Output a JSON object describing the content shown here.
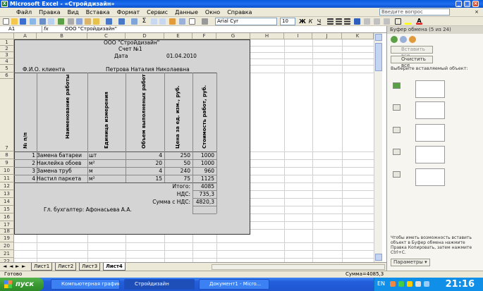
{
  "window": {
    "app_icon": "X",
    "title": "Microsoft Excel - «Стройдизайн»",
    "buttons": {
      "minimize": "_",
      "maximize": "□",
      "close": "×"
    }
  },
  "menu": {
    "items": [
      "Файл",
      "Правка",
      "Вид",
      "Вставка",
      "Формат",
      "Сервис",
      "Данные",
      "Окно",
      "Справка"
    ],
    "help_placeholder": "Введите вопрос",
    "mdi_close": "×"
  },
  "toolbar": {
    "font": "Arial Cyr",
    "size": "10",
    "zoom_label": "Σ"
  },
  "formula_bar": {
    "name_box": "A1",
    "fx": "fx",
    "content": "ООО \"Стройдизайн\""
  },
  "columns": [
    "A",
    "B",
    "C",
    "D",
    "E",
    "F",
    "G",
    "H",
    "I",
    "J",
    "K"
  ],
  "rows": [
    "1",
    "2",
    "3",
    "4",
    "5",
    "6",
    "7",
    "8",
    "9",
    "10",
    "11",
    "12",
    "13",
    "14",
    "15",
    "16",
    "17",
    "18",
    "19",
    "20",
    "21",
    "22",
    "23"
  ],
  "document": {
    "company": "ООО \"Стройдизайн\"",
    "invoice": "Счет №1",
    "date_label": "Дата",
    "date_value": "01.04.2010",
    "client_label": "Ф.И.О. клиента",
    "client_name": "Петрова Наталия Николаевна",
    "headers": {
      "num": "№ п/п",
      "work": "Наименование работы",
      "unit": "Единица измерения",
      "volume": "Объем выполненых работ",
      "price": "Цена за ед. изм., руб.",
      "cost": "Стоимость работ, руб."
    },
    "items": [
      {
        "num": "1",
        "work": "Замена батареи",
        "unit": "шт",
        "volume": "4",
        "price": "250",
        "cost": "1000"
      },
      {
        "num": "2",
        "work": "Наклейка обоев",
        "unit": "м²",
        "volume": "20",
        "price": "50",
        "cost": "1000"
      },
      {
        "num": "3",
        "work": "Замена труб",
        "unit": "м",
        "volume": "4",
        "price": "240",
        "cost": "960"
      },
      {
        "num": "4",
        "work": "Настил паркета",
        "unit": "м²",
        "volume": "15",
        "price": "75",
        "cost": "1125"
      }
    ],
    "total_label": "Итого:",
    "total_value": "4085",
    "nds_label": "НДС:",
    "nds_value": "735,3",
    "sum_label": "Сумма с НДС:",
    "sum_value": "4820,3",
    "signer": "Гл. бухгалтер: Афонасьева А.А."
  },
  "sheet_tabs": [
    "Лист1",
    "Лист2",
    "Лист3",
    "Лист4"
  ],
  "active_tab": "Лист4",
  "status": {
    "left": "Готово",
    "sum": "Сумма=4085,3"
  },
  "task_pane": {
    "title": "Буфер обмена (5 из 24)",
    "paste_all": "Вставить все",
    "clear_all": "Очистить все",
    "instruction": "Выберите вставляемый объект:",
    "items_count": 5,
    "footer_text": "Чтобы иметь возможность вставить объект в Буфер обмена нажмите Правка Копировать, затем нажмите Ctrl+C.",
    "options": "Параметры ▾"
  },
  "taskbar": {
    "start": "пуск",
    "tasks": [
      "Компьютерная графика",
      "Стройдизайн",
      "Документ1 - Micro..."
    ],
    "lang": "EN",
    "clock": "21:16"
  },
  "colors": {
    "title_blue": "#0a5ade",
    "excel_green": "#1d7b2f",
    "start_green": "#3a9b33",
    "selection_fill": "#d4d4d4"
  }
}
